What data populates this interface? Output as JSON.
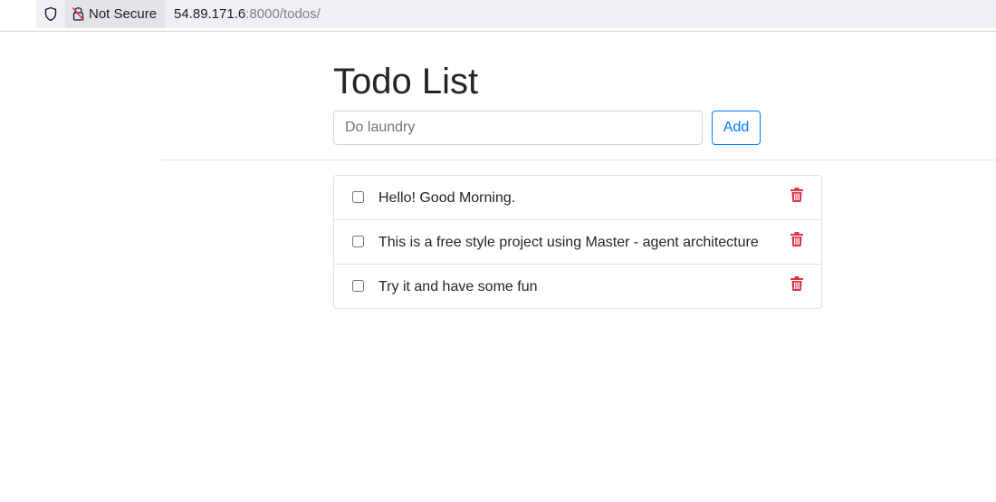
{
  "browser": {
    "security_label": "Not Secure",
    "url_host": "54.89.171.6",
    "url_rest": ":8000/todos/"
  },
  "page": {
    "title": "Todo List",
    "input_placeholder": "Do laundry",
    "input_value": "",
    "add_label": "Add"
  },
  "todos": [
    {
      "text": "Hello! Good Morning.",
      "done": false
    },
    {
      "text": "This is a free style project using Master - agent architecture",
      "done": false
    },
    {
      "text": "Try it and have some fun",
      "done": false
    }
  ],
  "colors": {
    "accent": "#007bff",
    "delete": "#dc3545",
    "border": "#dee2e6"
  },
  "icons": {
    "tracking": "shield-icon",
    "security": "lock-slash-icon",
    "delete": "trash-icon"
  }
}
